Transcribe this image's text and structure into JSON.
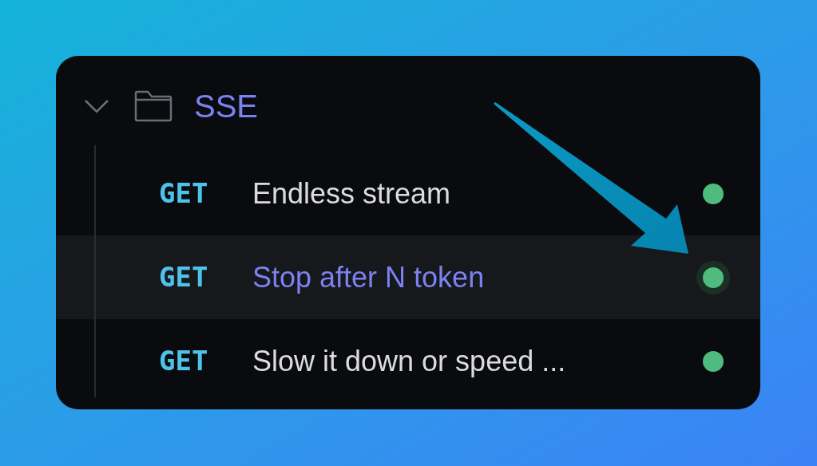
{
  "folder": {
    "name": "SSE",
    "expanded": true
  },
  "requests": [
    {
      "method": "GET",
      "name": "Endless stream",
      "selected": false
    },
    {
      "method": "GET",
      "name": "Stop after N token",
      "selected": true
    },
    {
      "method": "GET",
      "name": "Slow it down or speed ...",
      "selected": false
    }
  ]
}
